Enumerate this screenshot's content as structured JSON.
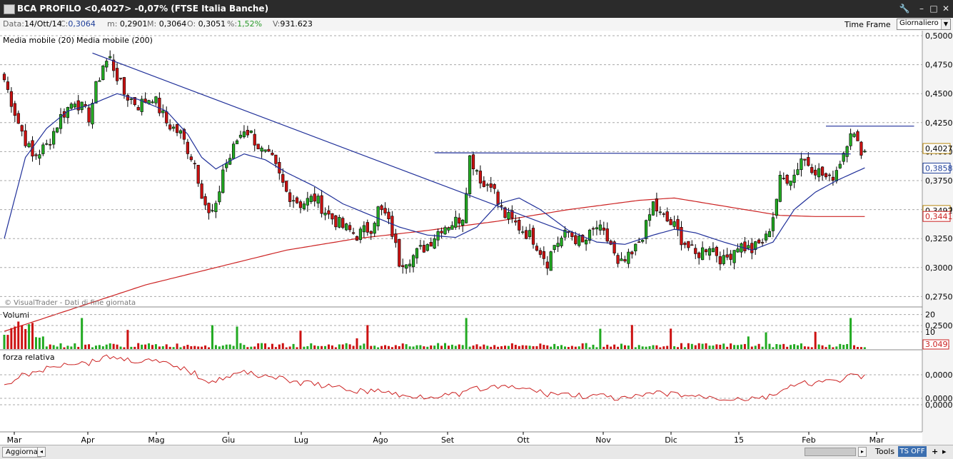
{
  "window": {
    "title": "BCA PROFILO <0,4027> -0,07%  (FTSE Italia Banche)",
    "buttons": {
      "tools_icon": "wrench-icon",
      "minimize": "–",
      "maximize": "□",
      "close": "✕"
    }
  },
  "info": {
    "date_label": "Data:",
    "date": "14/Ott/14",
    "c_label": "C:",
    "c": "0,3064",
    "m_label": "m:",
    "m": "0,2901",
    "M_label": "M:",
    "M": "0,3064",
    "o_label": "O:",
    "o": "0,3051",
    "pct_label": "%:",
    "pct": "1,52%",
    "v_label": "V:",
    "v": "931.623",
    "time_frame": "Time Frame",
    "time_frame_value": "Giornaliero"
  },
  "legend": {
    "ma20": "Media mobile (20)",
    "ma200": "Media mobile (200)"
  },
  "watermark": "© VisualTrader - Dati di fine giornata",
  "panels": {
    "volume": "Volumi",
    "rs": "forza relativa"
  },
  "price_badges": [
    {
      "text": "0,4027",
      "value": 0.4027,
      "border": "#b8860b"
    },
    {
      "text": "0,3858",
      "value": 0.3858,
      "border": "#1f3f99"
    },
    {
      "text": "0,3492",
      "value": 0.3492,
      "border": "#b8860b"
    },
    {
      "text": "0,3441",
      "value": 0.3441,
      "border": "#cc2222"
    }
  ],
  "volume_badge": "3.049.",
  "rs_ticks": [
    "0,0000",
    "0,0000",
    "0,0000"
  ],
  "colors": {
    "up": "#22aa22",
    "down": "#cc1111",
    "ma20": "#1f2f99",
    "ma200": "#cc2222",
    "trend": "#1f2f99"
  },
  "statusbar": {
    "refresh": "Aggiorna",
    "tools": "Tools",
    "ts": "TS OFF",
    "plus": "+",
    "arrow": "▸"
  },
  "chart_data": {
    "type": "candlestick",
    "y_ticks": [
      "0,5000",
      "0,4750",
      "0,4500",
      "0,4250",
      "0,4000",
      "0,3750",
      "0,3500",
      "0,3250",
      "0,3000",
      "0,2750",
      "0,2500"
    ],
    "ylim": [
      0.245,
      0.502
    ],
    "x_labels": [
      "Mar",
      "Apr",
      "Mag",
      "Giu",
      "Lug",
      "Ago",
      "Set",
      "Ott",
      "Nov",
      "Dic",
      "15",
      "Feb",
      "Mar"
    ],
    "volume_ticks": [
      "20",
      "10"
    ],
    "anchors": [
      [
        0,
        0.462
      ],
      [
        4,
        0.425
      ],
      [
        8,
        0.395
      ],
      [
        12,
        0.405
      ],
      [
        16,
        0.43
      ],
      [
        20,
        0.445
      ],
      [
        24,
        0.43
      ],
      [
        26,
        0.455
      ],
      [
        28,
        0.475
      ],
      [
        30,
        0.48
      ],
      [
        32,
        0.465
      ],
      [
        34,
        0.45
      ],
      [
        38,
        0.44
      ],
      [
        42,
        0.448
      ],
      [
        46,
        0.425
      ],
      [
        50,
        0.415
      ],
      [
        54,
        0.39
      ],
      [
        56,
        0.365
      ],
      [
        58,
        0.345
      ],
      [
        60,
        0.35
      ],
      [
        62,
        0.385
      ],
      [
        64,
        0.395
      ],
      [
        66,
        0.41
      ],
      [
        68,
        0.42
      ],
      [
        70,
        0.415
      ],
      [
        73,
        0.4
      ],
      [
        76,
        0.392
      ],
      [
        80,
        0.365
      ],
      [
        84,
        0.355
      ],
      [
        88,
        0.36
      ],
      [
        92,
        0.345
      ],
      [
        96,
        0.335
      ],
      [
        100,
        0.328
      ],
      [
        104,
        0.335
      ],
      [
        106,
        0.35
      ],
      [
        108,
        0.345
      ],
      [
        110,
        0.33
      ],
      [
        112,
        0.305
      ],
      [
        116,
        0.31
      ],
      [
        120,
        0.32
      ],
      [
        124,
        0.335
      ],
      [
        128,
        0.34
      ],
      [
        130,
        0.345
      ],
      [
        132,
        0.395
      ],
      [
        134,
        0.385
      ],
      [
        136,
        0.37
      ],
      [
        138,
        0.375
      ],
      [
        140,
        0.355
      ],
      [
        142,
        0.345
      ],
      [
        146,
        0.335
      ],
      [
        150,
        0.325
      ],
      [
        154,
        0.305
      ],
      [
        156,
        0.32
      ],
      [
        160,
        0.33
      ],
      [
        164,
        0.32
      ],
      [
        168,
        0.335
      ],
      [
        172,
        0.32
      ],
      [
        174,
        0.3
      ],
      [
        178,
        0.31
      ],
      [
        182,
        0.335
      ],
      [
        184,
        0.355
      ],
      [
        186,
        0.345
      ],
      [
        190,
        0.335
      ],
      [
        192,
        0.325
      ],
      [
        196,
        0.31
      ],
      [
        200,
        0.32
      ],
      [
        204,
        0.305
      ],
      [
        208,
        0.32
      ],
      [
        212,
        0.315
      ],
      [
        214,
        0.32
      ],
      [
        216,
        0.325
      ],
      [
        218,
        0.345
      ],
      [
        220,
        0.375
      ],
      [
        224,
        0.38
      ],
      [
        226,
        0.395
      ],
      [
        230,
        0.385
      ],
      [
        232,
        0.38
      ],
      [
        234,
        0.375
      ],
      [
        236,
        0.385
      ],
      [
        238,
        0.4
      ],
      [
        240,
        0.42
      ],
      [
        242,
        0.405
      ],
      [
        244,
        0.4
      ]
    ],
    "ma20_anchors": [
      [
        0,
        0.325
      ],
      [
        6,
        0.395
      ],
      [
        12,
        0.42
      ],
      [
        18,
        0.435
      ],
      [
        24,
        0.44
      ],
      [
        28,
        0.445
      ],
      [
        32,
        0.45
      ],
      [
        38,
        0.445
      ],
      [
        46,
        0.435
      ],
      [
        52,
        0.415
      ],
      [
        56,
        0.395
      ],
      [
        60,
        0.385
      ],
      [
        64,
        0.392
      ],
      [
        68,
        0.398
      ],
      [
        74,
        0.393
      ],
      [
        80,
        0.382
      ],
      [
        88,
        0.37
      ],
      [
        96,
        0.355
      ],
      [
        104,
        0.345
      ],
      [
        112,
        0.335
      ],
      [
        120,
        0.328
      ],
      [
        128,
        0.326
      ],
      [
        134,
        0.335
      ],
      [
        140,
        0.355
      ],
      [
        146,
        0.36
      ],
      [
        152,
        0.35
      ],
      [
        160,
        0.332
      ],
      [
        168,
        0.322
      ],
      [
        176,
        0.32
      ],
      [
        184,
        0.328
      ],
      [
        190,
        0.333
      ],
      [
        196,
        0.33
      ],
      [
        204,
        0.322
      ],
      [
        212,
        0.315
      ],
      [
        218,
        0.322
      ],
      [
        224,
        0.35
      ],
      [
        230,
        0.365
      ],
      [
        236,
        0.375
      ],
      [
        244,
        0.386
      ]
    ],
    "ma200_anchors": [
      [
        0,
        0.245
      ],
      [
        20,
        0.265
      ],
      [
        40,
        0.285
      ],
      [
        60,
        0.3
      ],
      [
        80,
        0.315
      ],
      [
        100,
        0.325
      ],
      [
        120,
        0.332
      ],
      [
        140,
        0.34
      ],
      [
        160,
        0.35
      ],
      [
        180,
        0.358
      ],
      [
        190,
        0.36
      ],
      [
        200,
        0.355
      ],
      [
        210,
        0.35
      ],
      [
        220,
        0.345
      ],
      [
        230,
        0.344
      ],
      [
        244,
        0.344
      ]
    ],
    "trendlines": [
      {
        "from": [
          25,
          0.485
        ],
        "to": [
          160,
          0.33
        ],
        "color": "#1f2f99"
      },
      {
        "from": [
          122,
          0.399
        ],
        "to": [
          240,
          0.398
        ],
        "color": "#1f2f99"
      },
      {
        "from": [
          233,
          0.422
        ],
        "to": [
          258,
          0.422
        ],
        "color": "#1f2f99"
      }
    ]
  }
}
